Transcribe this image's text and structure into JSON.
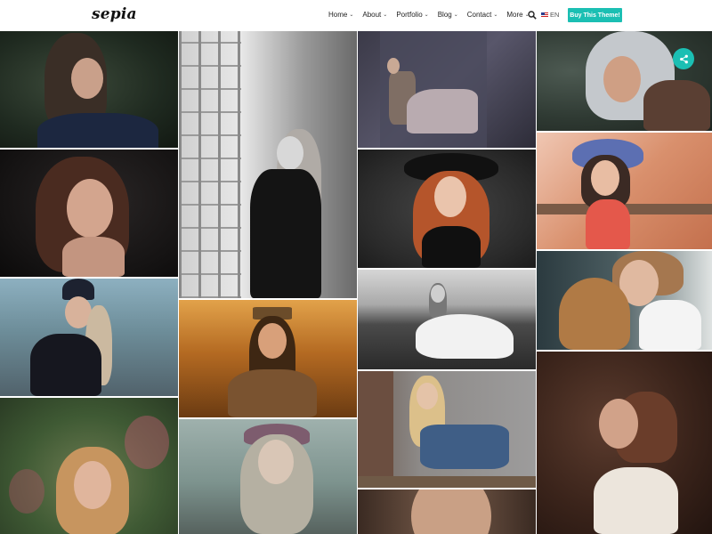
{
  "header": {
    "logo": "sepia",
    "nav": [
      {
        "label": "Home",
        "caret": "⌄"
      },
      {
        "label": "About",
        "caret": "⌄"
      },
      {
        "label": "Portfolio",
        "caret": "⌄"
      },
      {
        "label": "Blog",
        "caret": "⌄"
      },
      {
        "label": "Contact",
        "caret": "⌄"
      },
      {
        "label": "More",
        "caret": "⌄"
      }
    ],
    "language": "EN",
    "buy_button": "Buy This Theme!"
  },
  "colors": {
    "accent": "#1bbfb3"
  },
  "icons": {
    "search": "search-icon",
    "share": "share-icon",
    "flag": "uk-flag-icon"
  },
  "gallery": {
    "photos": [
      {
        "name": "portrait-dark-hair-green"
      },
      {
        "name": "portrait-black-white-fence"
      },
      {
        "name": "portrait-woman-on-chair"
      },
      {
        "name": "portrait-tattooed-woman"
      },
      {
        "name": "portrait-brunette-dark"
      },
      {
        "name": "portrait-redhead-black-hat"
      },
      {
        "name": "portrait-floral-sun-hat"
      },
      {
        "name": "portrait-beanie-road"
      },
      {
        "name": "portrait-bw-white-dress-field"
      },
      {
        "name": "portrait-with-cat"
      },
      {
        "name": "portrait-crown-golden-field"
      },
      {
        "name": "portrait-blonde-jeans-studio"
      },
      {
        "name": "portrait-profile-sweater"
      },
      {
        "name": "portrait-blonde-flowers"
      },
      {
        "name": "portrait-flower-crown"
      },
      {
        "name": "portrait-freckles-closeup"
      }
    ]
  }
}
